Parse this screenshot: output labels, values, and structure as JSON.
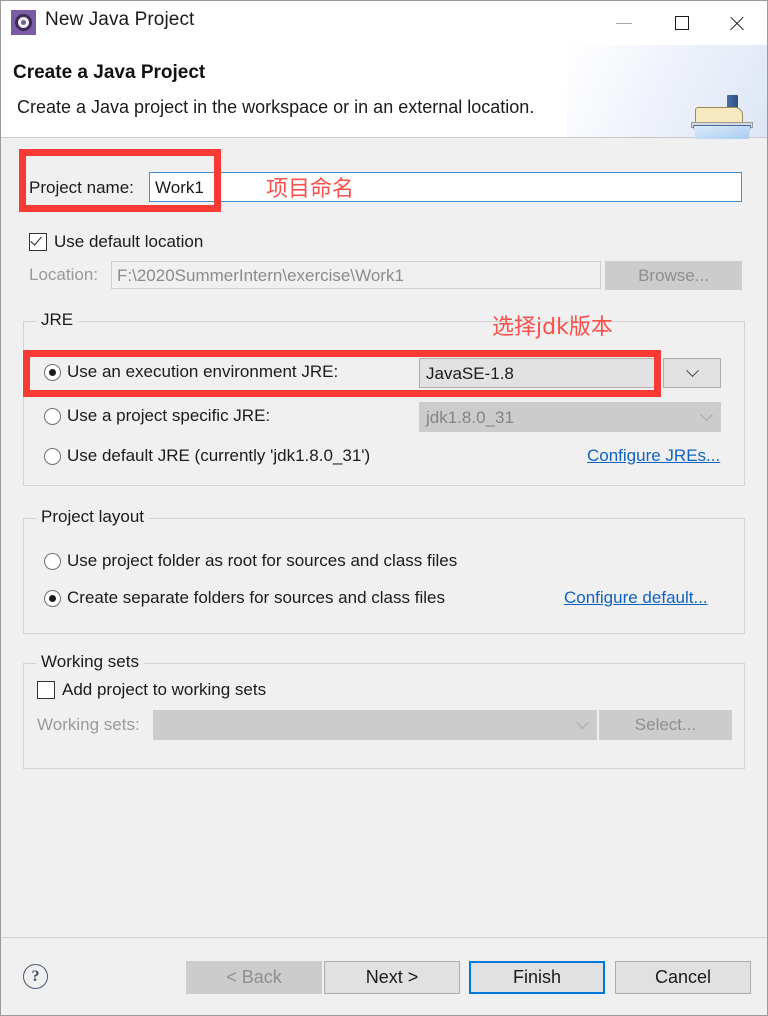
{
  "window": {
    "title": "New Java Project",
    "icon": "java-project-gear-icon",
    "controls": {
      "minimize": "minimize-icon",
      "maximize": "maximize-icon",
      "close": "close-icon"
    }
  },
  "banner": {
    "title": "Create a Java Project",
    "description": "Create a Java project in the workspace or in an external location.",
    "icon": "java-folder-icon"
  },
  "form": {
    "project_name_label": "Project name:",
    "project_name_value": "Work1",
    "use_default_location_label": "Use default location",
    "use_default_location_checked": true,
    "location_label": "Location:",
    "location_value": "F:\\2020SummerIntern\\exercise\\Work1",
    "browse_label": "Browse..."
  },
  "jre": {
    "legend": "JRE",
    "exec_env_label": "Use an execution environment JRE:",
    "exec_env_value": "JavaSE-1.8",
    "exec_env_selected": true,
    "project_jre_label": "Use a project specific JRE:",
    "project_jre_value": "jdk1.8.0_31",
    "default_jre_label": "Use default JRE (currently 'jdk1.8.0_31')",
    "configure_jres_link": "Configure JREs..."
  },
  "project_layout": {
    "legend": "Project layout",
    "use_project_folder_label": "Use project folder as root for sources and class files",
    "separate_folders_label": "Create separate folders for sources and class files",
    "separate_folders_selected": true,
    "configure_default_link": "Configure default..."
  },
  "working_sets": {
    "legend": "Working sets",
    "add_to_working_sets_label": "Add project to working sets",
    "add_to_working_sets_checked": false,
    "working_sets_label": "Working sets:",
    "working_sets_value": "",
    "select_label": "Select..."
  },
  "footer": {
    "help_label": "?",
    "back_label": "< Back",
    "back_disabled": true,
    "next_label": "Next >",
    "finish_label": "Finish",
    "finish_default": true,
    "cancel_label": "Cancel"
  },
  "annotations": {
    "project_name_note": "项目命名",
    "jre_note": "选择jdk版本",
    "color": "#f93a34"
  }
}
